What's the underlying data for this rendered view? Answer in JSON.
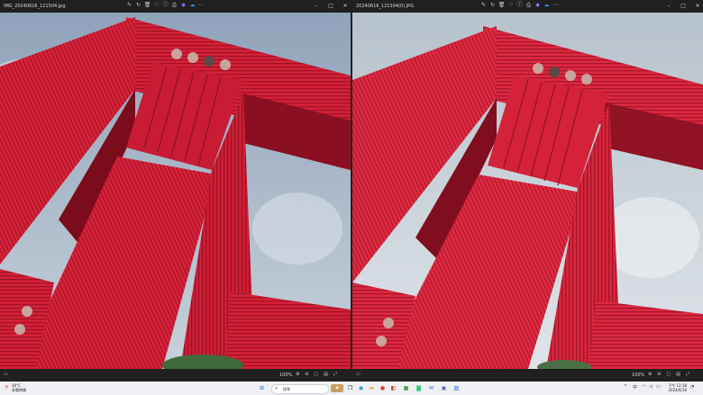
{
  "windows": [
    {
      "title": "IMG_20240616_121504.jpg",
      "zoom": "100%",
      "toolbar_icons": [
        "edit-image-icon",
        "rotate-icon",
        "delete-icon",
        "favorite-icon",
        "info-icon",
        "print-icon",
        "copilot-icon",
        "onedrive-icon",
        "more-icon"
      ],
      "controls": [
        "minimize-icon",
        "maximize-icon",
        "close-icon"
      ]
    },
    {
      "title": "20240616_121504(0).JPG",
      "zoom": "100%",
      "toolbar_icons": [
        "edit-image-icon",
        "rotate-icon",
        "delete-icon",
        "favorite-icon",
        "info-icon",
        "print-icon",
        "copilot-icon",
        "onedrive-icon",
        "more-icon"
      ],
      "controls": [
        "minimize-icon",
        "maximize-icon",
        "close-icon"
      ]
    }
  ],
  "taskbar": {
    "weather_temp": "30°C",
    "weather_desc": "多雲時晴",
    "search_placeholder": "搜尋",
    "time": "下午 12:18",
    "date": "2024/6/16",
    "input_method": "中",
    "apps": [
      "start-icon",
      "search-icon",
      "task-view-icon",
      "copilot-app-icon",
      "edge-icon",
      "explorer-icon",
      "chrome-icon",
      "office-icon",
      "store-icon",
      "line-icon",
      "mail-icon",
      "teams-icon",
      "photos-icon"
    ]
  },
  "colors": {
    "container_red": "#d8233a",
    "sky_left": "#aebccc",
    "sky_right": "#c9d3db"
  }
}
